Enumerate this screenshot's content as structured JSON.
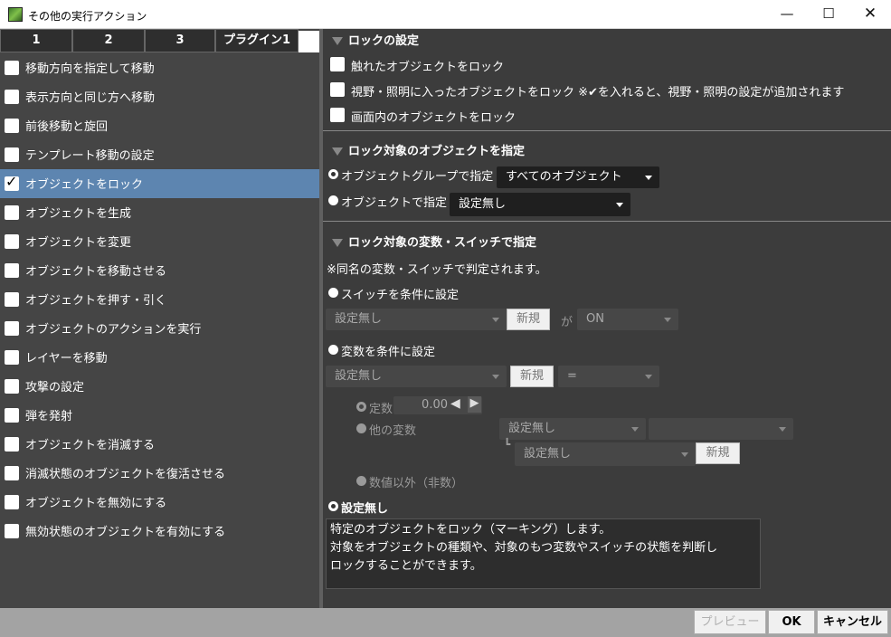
{
  "window": {
    "title": "その他の実行アクション",
    "minimize": "—",
    "maximize": "☐",
    "close": "✕"
  },
  "tabs": [
    "1",
    "2",
    "3",
    "プラグイン1"
  ],
  "action_list": [
    {
      "label": "移動方向を指定して移動",
      "checked": false
    },
    {
      "label": "表示方向と同じ方へ移動",
      "checked": false
    },
    {
      "label": "前後移動と旋回",
      "checked": false
    },
    {
      "label": "テンプレート移動の設定",
      "checked": false
    },
    {
      "label": "オブジェクトをロック",
      "checked": true
    },
    {
      "label": "オブジェクトを生成",
      "checked": false
    },
    {
      "label": "オブジェクトを変更",
      "checked": false
    },
    {
      "label": "オブジェクトを移動させる",
      "checked": false
    },
    {
      "label": "オブジェクトを押す・引く",
      "checked": false
    },
    {
      "label": "オブジェクトのアクションを実行",
      "checked": false
    },
    {
      "label": "レイヤーを移動",
      "checked": false
    },
    {
      "label": "攻撃の設定",
      "checked": false
    },
    {
      "label": "弾を発射",
      "checked": false
    },
    {
      "label": "オブジェクトを消滅する",
      "checked": false
    },
    {
      "label": "消滅状態のオブジェクトを復活させる",
      "checked": false
    },
    {
      "label": "オブジェクトを無効にする",
      "checked": false
    },
    {
      "label": "無効状態のオブジェクトを有効にする",
      "checked": false
    }
  ],
  "lock": {
    "section_title": "ロックの設定",
    "opt_touched": "触れたオブジェクトをロック",
    "opt_view": "視野・照明に入ったオブジェクトをロック ※✔を入れると、視野・照明の設定が追加されます",
    "opt_screen": "画面内のオブジェクトをロック"
  },
  "target": {
    "section_title": "ロック対象のオブジェクトを指定",
    "by_group_label": "オブジェクトグループで指定",
    "group_value": "すべてのオブジェクト",
    "by_object_label": "オブジェクトで指定",
    "object_value": "設定無し"
  },
  "vars": {
    "section_title": "ロック対象の変数・スイッチで指定",
    "note": "※同名の変数・スイッチで判定されます。",
    "switch_label": "スイッチを条件に設定",
    "switch_value": "設定無し",
    "new_label": "新規",
    "ga": "が",
    "switch_state": "ON",
    "variable_label": "変数を条件に設定",
    "variable_value": "設定無し",
    "operator": "=",
    "const_label": "定数",
    "const_value": "0.00",
    "other_var_label": "他の変数",
    "other_var_value": "設定無し",
    "other_var_second": "",
    "sub_var_value": "設定無し",
    "non_numeric_label": "数値以外（非数）",
    "none_label": "設定無し"
  },
  "description": [
    "特定のオブジェクトをロック（マーキング）します。",
    "対象をオブジェクトの種類や、対象のもつ変数やスイッチの状態を判断し",
    "ロックすることができます。"
  ],
  "footer": {
    "preview": "プレビュー",
    "ok": "OK",
    "cancel": "キャンセル"
  }
}
